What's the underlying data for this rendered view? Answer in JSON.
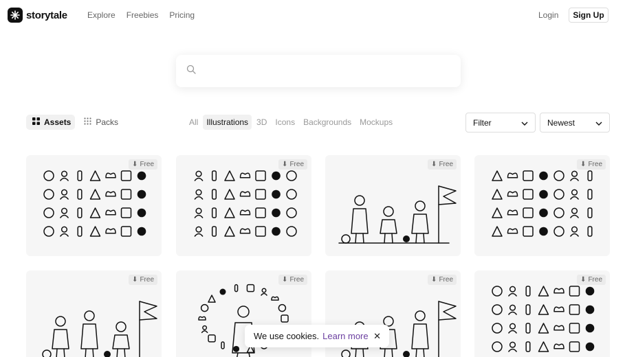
{
  "brand": {
    "name": "storytale"
  },
  "nav": [
    {
      "label": "Explore"
    },
    {
      "label": "Freebies"
    },
    {
      "label": "Pricing"
    }
  ],
  "auth": {
    "login": "Login",
    "signup": "Sign Up"
  },
  "search": {
    "value": "",
    "placeholder": ""
  },
  "view_toggle": [
    {
      "label": "Assets",
      "active": true
    },
    {
      "label": "Packs",
      "active": false
    }
  ],
  "categories": [
    {
      "label": "All",
      "active": false
    },
    {
      "label": "Illustrations",
      "active": true
    },
    {
      "label": "3D",
      "active": false
    },
    {
      "label": "Icons",
      "active": false
    },
    {
      "label": "Backgrounds",
      "active": false
    },
    {
      "label": "Mockups",
      "active": false
    }
  ],
  "filter": {
    "label": "Filter"
  },
  "sort": {
    "label": "Newest"
  },
  "cards": [
    {
      "badge": "Free",
      "kind": "icon-grid"
    },
    {
      "badge": "Free",
      "kind": "icon-grid"
    },
    {
      "badge": "Free",
      "kind": "scene"
    },
    {
      "badge": "Free",
      "kind": "icon-grid"
    },
    {
      "badge": "Free",
      "kind": "scene"
    },
    {
      "badge": "Free",
      "kind": "doodle"
    },
    {
      "badge": "Free",
      "kind": "scene"
    },
    {
      "badge": "Free",
      "kind": "icon-grid"
    }
  ],
  "cookie": {
    "text": "We use cookies.",
    "link": "Learn more"
  },
  "colors": {
    "accent_link": "#6b3fa0",
    "card_bg": "#f6f6f6",
    "text": "#111111"
  }
}
